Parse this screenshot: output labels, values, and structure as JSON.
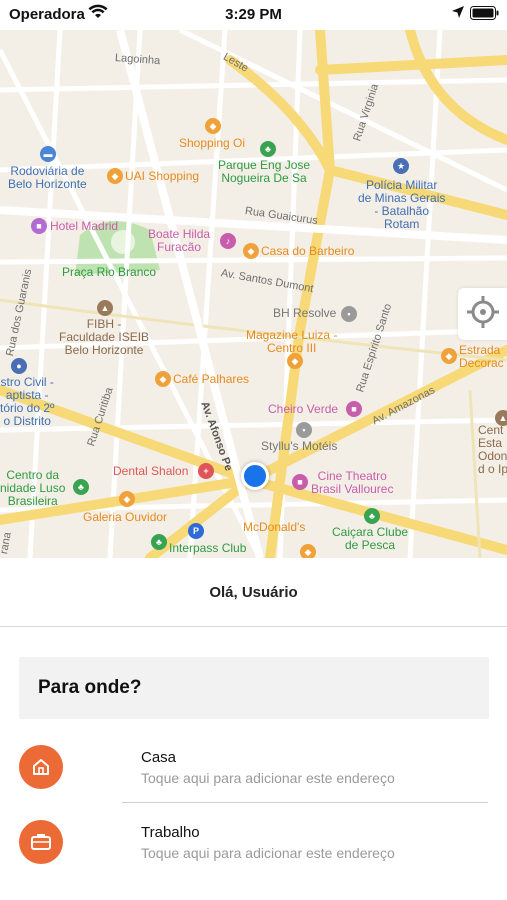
{
  "status_bar": {
    "carrier": "Operadora",
    "time": "3:29 PM"
  },
  "map": {
    "pois": [
      {
        "id": "shopping-oi",
        "text": "Shopping Oi",
        "color": "orange"
      },
      {
        "id": "parque",
        "text": "Parque Eng Jose\nNogueira De Sa",
        "color": "green"
      },
      {
        "id": "rodoviaria",
        "text": "Rodoviária de\nBelo Horizonte",
        "color": "blue"
      },
      {
        "id": "uai",
        "text": "UAI Shopping",
        "color": "orange"
      },
      {
        "id": "policia",
        "text": "Polícia Militar\nde Minas Gerais\n- Batalhão\nRotam",
        "color": "blue"
      },
      {
        "id": "hotel",
        "text": "Hotel Madrid",
        "color": "pink"
      },
      {
        "id": "boate",
        "text": "Boate Hilda\nFuracão",
        "color": "pink"
      },
      {
        "id": "barbeiro",
        "text": "Casa do Barbeiro",
        "color": "orange"
      },
      {
        "id": "praca",
        "text": "Praça Rio Branco",
        "color": "green"
      },
      {
        "id": "fibh",
        "text": "FIBH -\nFaculdade ISEIB\nBelo Horizonte",
        "color": "brown"
      },
      {
        "id": "bh-resolve",
        "text": "BH Resolve",
        "color": "gray"
      },
      {
        "id": "magazine",
        "text": "Magazine Luiza -\nCentro III",
        "color": "orange"
      },
      {
        "id": "estrada",
        "text": "Estrada\nDecorac",
        "color": "orange"
      },
      {
        "id": "civil",
        "text": "stro Civil -\naptista -\ntório do 2º\no Distrito",
        "color": "blue"
      },
      {
        "id": "cafe",
        "text": "Café Palhares",
        "color": "orange"
      },
      {
        "id": "cheiro",
        "text": "Cheiro Verde",
        "color": "pink"
      },
      {
        "id": "styllu",
        "text": "Styllu's Motéis",
        "color": "gray"
      },
      {
        "id": "cent",
        "text": "Cent\nEsta\nOdonto\nd o Ipi",
        "color": "brown"
      },
      {
        "id": "centro-luso",
        "text": "Centro da\nnidade Luso\nBrasileira",
        "color": "green"
      },
      {
        "id": "dental",
        "text": "Dental Shalon",
        "color": "red"
      },
      {
        "id": "cine",
        "text": "Cine Theatro\nBrasil Vallourec",
        "color": "pink"
      },
      {
        "id": "galeria",
        "text": "Galeria Ouvidor",
        "color": "orange"
      },
      {
        "id": "mcdonalds",
        "text": "McDonald's",
        "color": "orange"
      },
      {
        "id": "caicara",
        "text": "Caiçara Clube\nde Pesca",
        "color": "green"
      },
      {
        "id": "interpass",
        "text": "Interpass Club",
        "color": "green"
      }
    ],
    "streets": [
      {
        "id": "guaicurus",
        "text": "Rua Guaicurus"
      },
      {
        "id": "santos",
        "text": "Av. Santos Dumont"
      },
      {
        "id": "espirito",
        "text": "Rua Espírito Santo"
      },
      {
        "id": "amazonas",
        "text": "Av. Amazonas"
      },
      {
        "id": "afonso",
        "text": "Av. Afonso Pe"
      },
      {
        "id": "curitiba",
        "text": "Rua Curitiba"
      },
      {
        "id": "guaranis",
        "text": "Rua dos Guaranis"
      },
      {
        "id": "lagoinha",
        "text": "Lagoinha"
      },
      {
        "id": "leste",
        "text": "Leste"
      },
      {
        "id": "virginia",
        "text": "Rua Virginia"
      },
      {
        "id": "arana",
        "text": "rana"
      }
    ]
  },
  "greeting": "Olá, Usuário",
  "search": {
    "label": "Para onde?"
  },
  "places": [
    {
      "title": "Casa",
      "subtitle": "Toque aqui para adicionar este endereço",
      "icon": "home-icon"
    },
    {
      "title": "Trabalho",
      "subtitle": "Toque aqui para adicionar este endereço",
      "icon": "briefcase-icon"
    }
  ],
  "colors": {
    "accent": "#ec6a36",
    "user_location": "#1a73e8"
  }
}
